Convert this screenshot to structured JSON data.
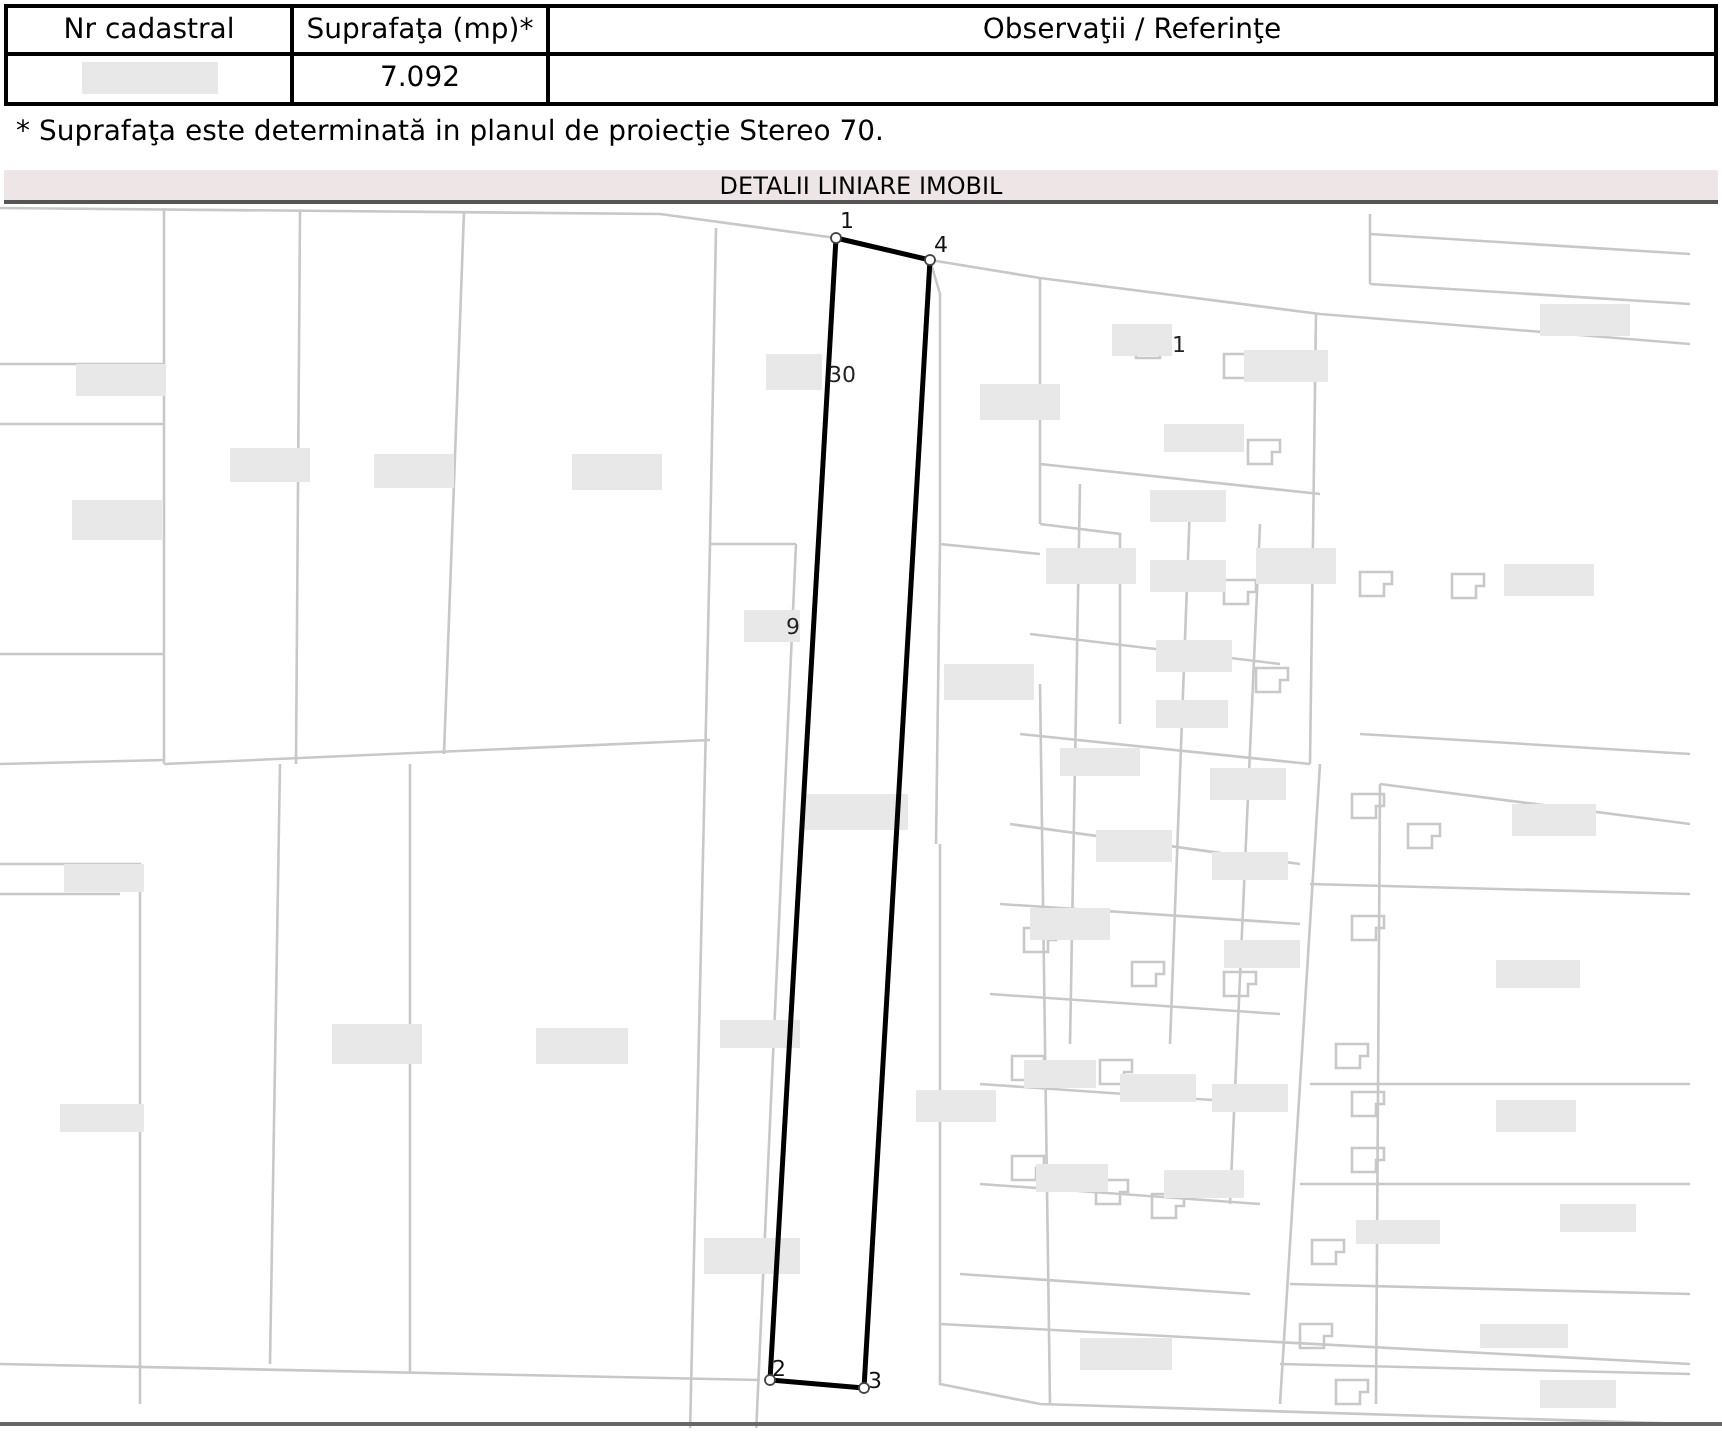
{
  "table": {
    "columns": [
      "Nr cadastral",
      "Suprafaţa (mp)*",
      "Observaţii / Referinţe"
    ],
    "rows": [
      {
        "cadastral_redacted": true,
        "area": "7.092"
      }
    ]
  },
  "note": "* Suprafaţa este determinată in planul de proiecţie Stereo 70.",
  "section": {
    "title": "DETALII LINIARE IMOBIL"
  },
  "map": {
    "vertices": [
      {
        "label": "1"
      },
      {
        "label": "4"
      },
      {
        "label": "2"
      },
      {
        "label": "3"
      }
    ],
    "labels": [
      "1",
      "30",
      "9"
    ]
  }
}
